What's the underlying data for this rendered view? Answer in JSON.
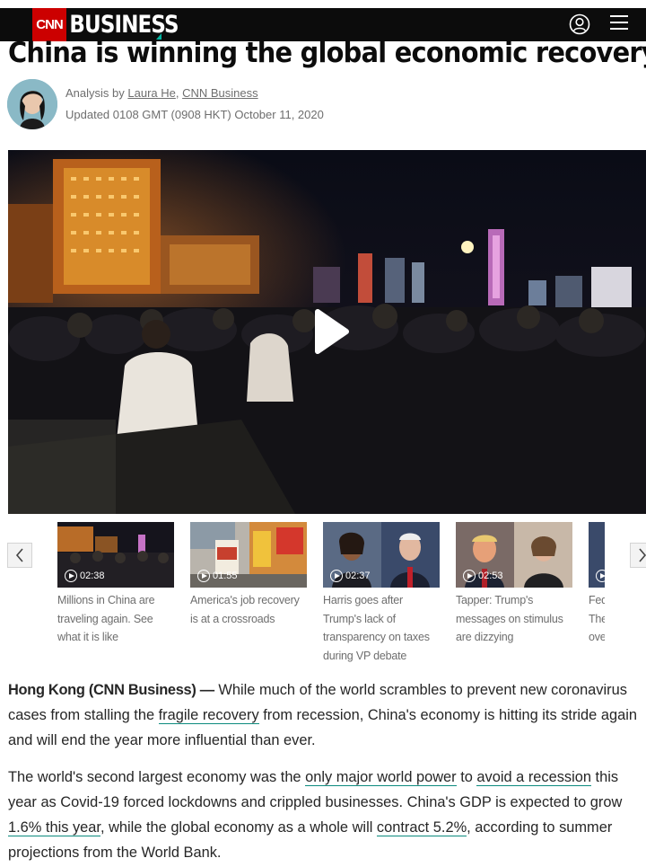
{
  "header": {
    "brand_network": "CNN",
    "brand_section": "BUSINESS",
    "icons": [
      "user-icon",
      "menu-icon"
    ]
  },
  "article": {
    "headline": "China is winning the global economic recovery",
    "byline_prefix": "Analysis by ",
    "author": "Laura He",
    "byline_sep": ", ",
    "outlet": "CNN Business",
    "updated": "Updated 0108 GMT (0908 HKT) October 11, 2020"
  },
  "video": {
    "player": "play-icon"
  },
  "carousel": {
    "prev_icon": "chevron-left-icon",
    "next_icon": "chevron-right-icon",
    "items": [
      {
        "duration": "02:38",
        "caption": "Millions in China are traveling again. See what it is like"
      },
      {
        "duration": "01:55",
        "caption": "America's job recovery is at a crossroads"
      },
      {
        "duration": "02:37",
        "caption": "Harris goes after Trump's lack of transparency on taxes during VP debate"
      },
      {
        "duration": "02:53",
        "caption": "Tapper: Trump's messages on stimulus are dizzying"
      },
      {
        "duration": "",
        "caption": "Fed The ove"
      }
    ]
  },
  "body": {
    "p1_dateline": "Hong Kong (CNN Business) —",
    "p1_a": " While much of the world scrambles to prevent new coronavirus cases from stalling the ",
    "p1_link": "fragile recovery",
    "p1_b": " from recession, China's economy is hitting its stride again and will end the year more influential than ever.",
    "p2_a": "The world's second largest economy was the ",
    "p2_link1": "only major world power",
    "p2_b": " to ",
    "p2_link2": "avoid a recession",
    "p2_c": " this year as Covid-19 forced lockdowns and crippled businesses. China's GDP is expected to grow ",
    "p2_link3": "1.6% this year",
    "p2_d": ", while the global economy as a whole will ",
    "p2_link4": "contract 5.2%",
    "p2_e": ", according to summer projections from the World Bank."
  },
  "colors": {
    "brand_red": "#cc0000",
    "link_underline": "#0c8b7e",
    "header_bg": "#0c0c0c"
  }
}
